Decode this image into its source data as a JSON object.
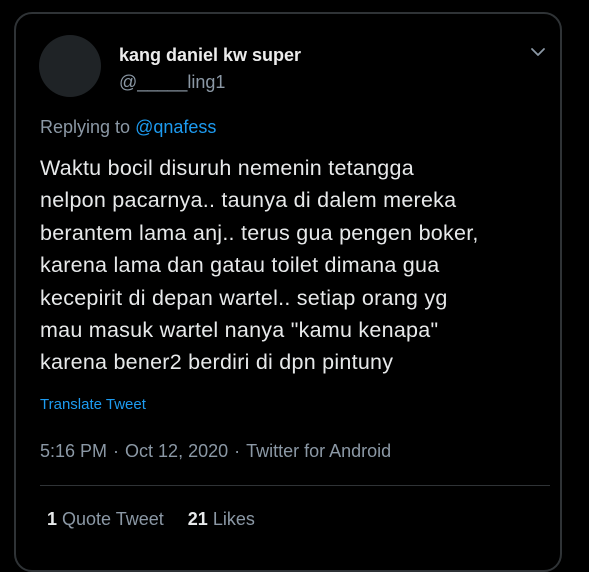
{
  "tweet": {
    "author_name": "kang daniel kw super",
    "author_handle": "@_____ling1",
    "replying_prefix": "Replying to",
    "replying_to": "@qnafess",
    "body_lines": [
      "Waktu bocil disuruh nemenin tetangga",
      "nelpon pacarnya.. taunya di dalem mereka",
      "berantem lama anj.. terus gua pengen boker,",
      "karena lama dan gatau toilet dimana gua",
      "kecepirit di depan wartel.. setiap orang yg",
      "mau masuk wartel nanya \"kamu kenapa\"",
      "karena bener2 berdiri di dpn pintuny"
    ],
    "translate_label": "Translate Tweet",
    "time": "5:16 PM",
    "date": "Oct 12, 2020",
    "source": "Twitter for Android",
    "separator": "·",
    "quote_count": "1",
    "quote_label": "Quote Tweet",
    "like_count": "21",
    "like_label": "Likes"
  },
  "icons": {
    "more": "chevron-down-icon"
  },
  "colors": {
    "background": "#000000",
    "text": "#e7e9ea",
    "secondary": "#8b98a5",
    "accent": "#1d9bf0",
    "border": "#2f3336"
  }
}
